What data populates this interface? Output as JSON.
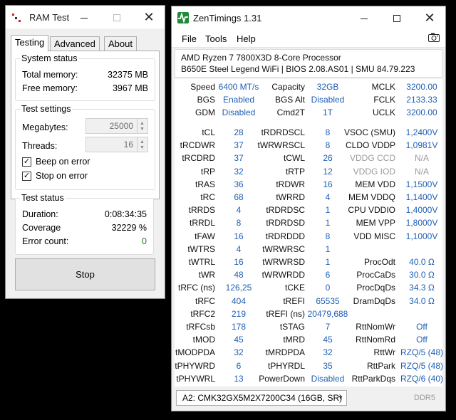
{
  "ram_window": {
    "title": "RAM Test",
    "tabs": [
      "Testing",
      "Advanced",
      "About"
    ],
    "system_status": {
      "legend": "System status",
      "total_memory_label": "Total memory:",
      "total_memory_value": "32375 MB",
      "free_memory_label": "Free memory:",
      "free_memory_value": "3967 MB"
    },
    "test_settings": {
      "legend": "Test settings",
      "megabytes_label": "Megabytes:",
      "megabytes_value": "25000",
      "threads_label": "Threads:",
      "threads_value": "16",
      "beep_label": "Beep on error",
      "beep_checked": true,
      "stop_label": "Stop on error",
      "stop_checked": true
    },
    "test_status": {
      "legend": "Test status",
      "duration_label": "Duration:",
      "duration_value": "0:08:34:35",
      "coverage_label": "Coverage",
      "coverage_value": "32229 %",
      "error_label": "Error count:",
      "error_value": "0",
      "error_color": "#1a7f1a"
    },
    "stop_button": "Stop"
  },
  "zen_window": {
    "title": "ZenTimings 1.31",
    "menu": [
      "File",
      "Tools",
      "Help"
    ],
    "cpu": "AMD Ryzen 7 7800X3D 8-Core Processor",
    "board": "B650E Steel Legend WiFi | BIOS 2.08.AS01 | SMU 84.79.223",
    "value_color": "#1f5fb4",
    "top_rows": [
      [
        "Speed",
        "6400 MT/s",
        "Capacity",
        "32GB",
        "MCLK",
        "3200.00"
      ],
      [
        "BGS",
        "Enabled",
        "BGS Alt",
        "Disabled",
        "FCLK",
        "2133.33"
      ],
      [
        "GDM",
        "Disabled",
        "Cmd2T",
        "1T",
        "UCLK",
        "3200.00"
      ]
    ],
    "timing_rows": [
      [
        "tCL",
        "28",
        "tRDRDSCL",
        "8",
        "VSOC (SMU)",
        "1,2400V"
      ],
      [
        "tRCDWR",
        "37",
        "tWRWRSCL",
        "8",
        "CLDO VDDP",
        "1,0981V"
      ],
      [
        "tRCDRD",
        "37",
        "tCWL",
        "26",
        "VDDG CCD",
        "N/A"
      ],
      [
        "tRP",
        "32",
        "tRTP",
        "12",
        "VDDG IOD",
        "N/A"
      ],
      [
        "tRAS",
        "36",
        "tRDWR",
        "16",
        "MEM VDD",
        "1,1500V"
      ],
      [
        "tRC",
        "68",
        "tWRRD",
        "4",
        "MEM VDDQ",
        "1,1400V"
      ],
      [
        "tRRDS",
        "4",
        "tRDRDSC",
        "1",
        "CPU VDDIO",
        "1,4000V"
      ],
      [
        "tRRDL",
        "8",
        "tRDRDSD",
        "1",
        "MEM VPP",
        "1,8000V"
      ],
      [
        "tFAW",
        "16",
        "tRDRDDD",
        "8",
        "VDD MISC",
        "1,1000V"
      ],
      [
        "tWTRS",
        "4",
        "tWRWRSC",
        "1",
        "",
        ""
      ],
      [
        "tWTRL",
        "16",
        "tWRWRSD",
        "1",
        "ProcOdt",
        "40.0 Ω"
      ],
      [
        "tWR",
        "48",
        "tWRWRDD",
        "6",
        "ProcCaDs",
        "30.0 Ω"
      ],
      [
        "tRFC (ns)",
        "126,25",
        "tCKE",
        "0",
        "ProcDqDs",
        "34.3 Ω"
      ],
      [
        "tRFC",
        "404",
        "tREFI",
        "65535",
        "DramDqDs",
        "34.0 Ω"
      ],
      [
        "tRFC2",
        "219",
        "tREFI (ns)",
        "20479,688",
        "",
        ""
      ],
      [
        "tRFCsb",
        "178",
        "tSTAG",
        "7",
        "RttNomWr",
        "Off"
      ],
      [
        "tMOD",
        "45",
        "tMRD",
        "45",
        "RttNomRd",
        "Off"
      ],
      [
        "tMODPDA",
        "32",
        "tMRDPDA",
        "32",
        "RttWr",
        "RZQ/5 (48)"
      ],
      [
        "tPHYWRD",
        "6",
        "tPHYRDL",
        "35",
        "RttPark",
        "RZQ/5 (48)"
      ],
      [
        "tPHYWRL",
        "13",
        "PowerDown",
        "Disabled",
        "RttParkDqs",
        "RZQ/6 (40)"
      ]
    ],
    "grey_labels": [
      "VDDG CCD",
      "VDDG IOD"
    ],
    "dimm_select": "A2: CMK32GX5M2X7200C34 (16GB, SR)",
    "ddr_label": "DDR5"
  }
}
